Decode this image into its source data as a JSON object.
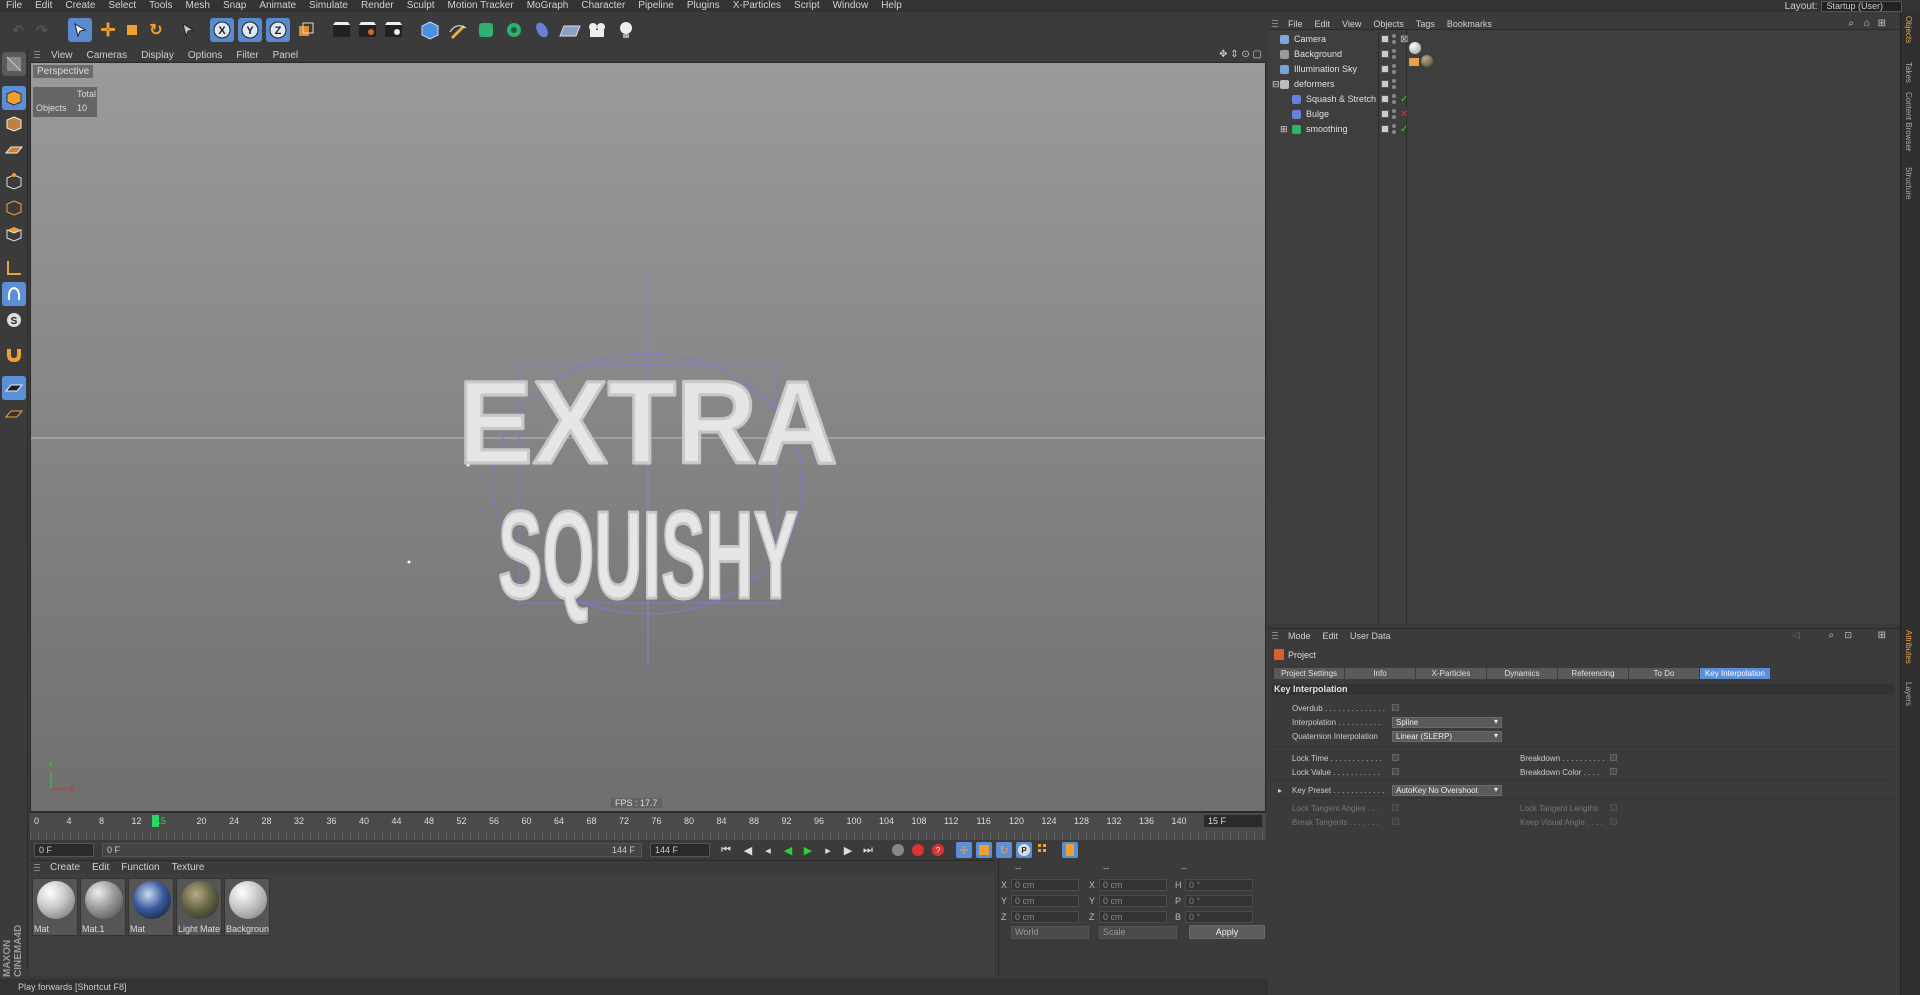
{
  "menubar": {
    "items": [
      "File",
      "Edit",
      "Create",
      "Select",
      "Tools",
      "Mesh",
      "Snap",
      "Animate",
      "Simulate",
      "Render",
      "Sculpt",
      "Motion Tracker",
      "MoGraph",
      "Character",
      "Pipeline",
      "Plugins",
      "X-Particles",
      "Script",
      "Window",
      "Help"
    ],
    "layout_label": "Layout:",
    "layout_value": "Startup (User)"
  },
  "viewport": {
    "menu": [
      "View",
      "Cameras",
      "Display",
      "Options",
      "Filter",
      "Panel"
    ],
    "camera_label": "Perspective",
    "hud": {
      "header": "Total",
      "row_label": "Objects",
      "row_value": "10"
    },
    "fps": "FPS : 17.7",
    "text_line1": "EXTRA",
    "text_line2": "SQUISHY"
  },
  "timeline": {
    "ticks": [
      "0",
      "4",
      "8",
      "12",
      "15",
      "20",
      "24",
      "28",
      "32",
      "36",
      "40",
      "44",
      "48",
      "52",
      "56",
      "60",
      "64",
      "68",
      "72",
      "76",
      "80",
      "84",
      "88",
      "92",
      "96",
      "100",
      "104",
      "108",
      "112",
      "116",
      "120",
      "124",
      "128",
      "132",
      "136",
      "140",
      "144"
    ],
    "current": "15 F",
    "current_frame": 15,
    "max_frame": 144
  },
  "transport": {
    "start": "0 F",
    "range_start": "0 F",
    "range_end": "144 F",
    "end": "144 F"
  },
  "materials": {
    "menu": [
      "Create",
      "Edit",
      "Function",
      "Texture"
    ],
    "items": [
      {
        "label": "Mat"
      },
      {
        "label": "Mat.1"
      },
      {
        "label": "Mat"
      },
      {
        "label": "Light Mate"
      },
      {
        "label": "Backgroun"
      }
    ]
  },
  "coords": {
    "headers": [
      "--",
      "--",
      "--"
    ],
    "rows": [
      {
        "a": "X",
        "av": "0 cm",
        "b": "X",
        "bv": "0 cm",
        "c": "H",
        "cv": "0 °"
      },
      {
        "a": "Y",
        "av": "0 cm",
        "b": "Y",
        "bv": "0 cm",
        "c": "P",
        "cv": "0 °"
      },
      {
        "a": "Z",
        "av": "0 cm",
        "b": "Z",
        "bv": "0 cm",
        "c": "B",
        "cv": "0 °"
      }
    ],
    "mode1": "World",
    "mode2": "Scale",
    "apply": "Apply"
  },
  "status": "Play forwards [Shortcut F8]",
  "brand": "MAXON CINEMA4D",
  "object_manager": {
    "menu": [
      "File",
      "Edit",
      "View",
      "Objects",
      "Tags",
      "Bookmarks"
    ],
    "objects": [
      {
        "name": "Camera",
        "indent": 0,
        "color": "#7fa8d8"
      },
      {
        "name": "Background",
        "indent": 0,
        "color": "#9a9a9a"
      },
      {
        "name": "Illumination Sky",
        "indent": 0,
        "color": "#79a3d4"
      },
      {
        "name": "deformers",
        "indent": 0,
        "color": "#bcbcbc"
      },
      {
        "name": "Squash & Stretch",
        "indent": 1,
        "color": "#6b7fd8"
      },
      {
        "name": "Bulge",
        "indent": 1,
        "color": "#6b7fd8"
      },
      {
        "name": "smoothing",
        "indent": 1,
        "color": "#2fb36b"
      }
    ]
  },
  "right_tabs": [
    "Objects",
    "Takes",
    "Content Browser",
    "Structure",
    "Attributes",
    "Layers"
  ],
  "attributes": {
    "menu": [
      "Mode",
      "Edit",
      "User Data"
    ],
    "title": "Project",
    "tabs": [
      "Project Settings",
      "Info",
      "X-Particles",
      "Dynamics",
      "Referencing",
      "To Do",
      "Key Interpolation"
    ],
    "section": "Key Interpolation",
    "overdub": "Overdub . . . . . . . . . . . . . .",
    "interpolation": "Interpolation . . . . . . . . . .",
    "interpolation_value": "Spline",
    "quaternion": "Quaternion Interpolation",
    "quaternion_value": "Linear (SLERP)",
    "lock_time": "Lock Time . . . . . . . . . . . .",
    "lock_value": "Lock Value . . . . . . . . . . .",
    "breakdown": "Breakdown . . . . . . . . . .",
    "breakdown_color": "Breakdown Color . . . .",
    "key_preset": "Key Preset . . . . . . . . . . . .",
    "key_preset_value": "AutoKey No Overshoot",
    "lock_tangent_angles": "Lock Tangent Angles . . .",
    "break_tangents": "Break Tangents . . . . . . .",
    "lock_tangent_lengths": "Lock Tangent Lengths",
    "keep_visual_angle": "Keep Visual Angle . . . ."
  },
  "colors": {
    "accent": "#5b8fd8",
    "marker": "#29d663",
    "warning": "#e8a24a"
  }
}
